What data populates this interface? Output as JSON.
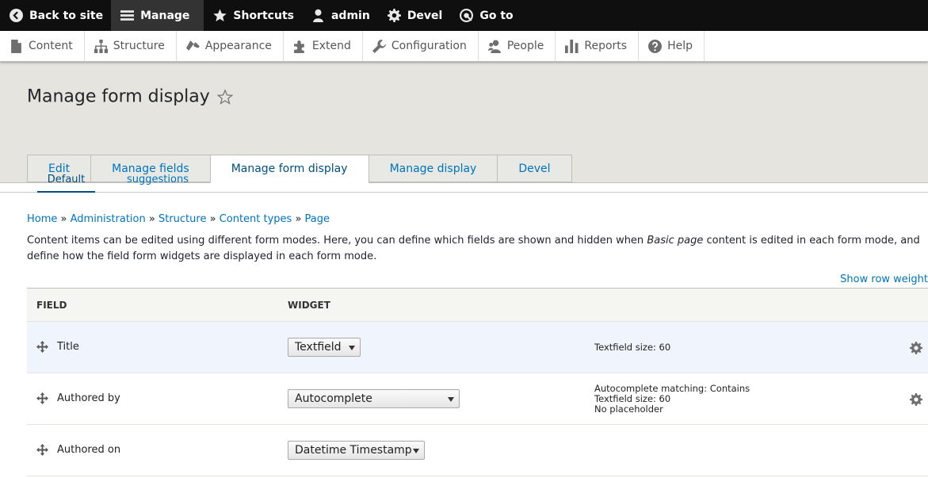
{
  "toolbar": {
    "items": [
      {
        "label": "Back to site",
        "icon": "back-icon"
      },
      {
        "label": "Manage",
        "icon": "menu-icon"
      },
      {
        "label": "Shortcuts",
        "icon": "star-icon"
      },
      {
        "label": "admin",
        "icon": "user-icon"
      },
      {
        "label": "Devel",
        "icon": "gear-icon"
      },
      {
        "label": "Go to",
        "icon": "goto-icon"
      }
    ]
  },
  "tray": {
    "items": [
      {
        "label": "Content",
        "icon": "document-icon"
      },
      {
        "label": "Structure",
        "icon": "structure-icon"
      },
      {
        "label": "Appearance",
        "icon": "brush-icon"
      },
      {
        "label": "Extend",
        "icon": "puzzle-icon"
      },
      {
        "label": "Configuration",
        "icon": "wrench-icon"
      },
      {
        "label": "People",
        "icon": "people-icon"
      },
      {
        "label": "Reports",
        "icon": "chart-icon"
      },
      {
        "label": "Help",
        "icon": "help-icon"
      }
    ]
  },
  "page": {
    "title": "Manage form display"
  },
  "tabs": [
    "Edit",
    "Manage fields",
    "Manage form display",
    "Manage display",
    "Devel"
  ],
  "secondary_tabs": [
    "Default",
    "suggestions"
  ],
  "breadcrumb": [
    "Home",
    "Administration",
    "Structure",
    "Content types",
    "Page"
  ],
  "description": {
    "before": "Content items can be edited using different form modes. Here, you can define which fields are shown and hidden when ",
    "em": "Basic page",
    "after": " content is edited in each form mode, and define how the field form widgets are displayed in each form mode."
  },
  "show_row_weights": "Show row weight",
  "table": {
    "headers": {
      "field": "FIELD",
      "widget": "WIDGET"
    },
    "rows": [
      {
        "field": "Title",
        "widget": "Textfield",
        "summary": [
          "Textfield size: 60"
        ]
      },
      {
        "field": "Authored by",
        "widget": "Autocomplete",
        "summary": [
          "Autocomplete matching: Contains",
          "Textfield size: 60",
          "No placeholder"
        ]
      },
      {
        "field": "Authored on",
        "widget": "Datetime Timestamp",
        "summary": []
      }
    ]
  },
  "colors": {
    "link": "#0074bd",
    "toolbar_bg": "#0f0f0f",
    "header_bg": "#e6e4df"
  }
}
